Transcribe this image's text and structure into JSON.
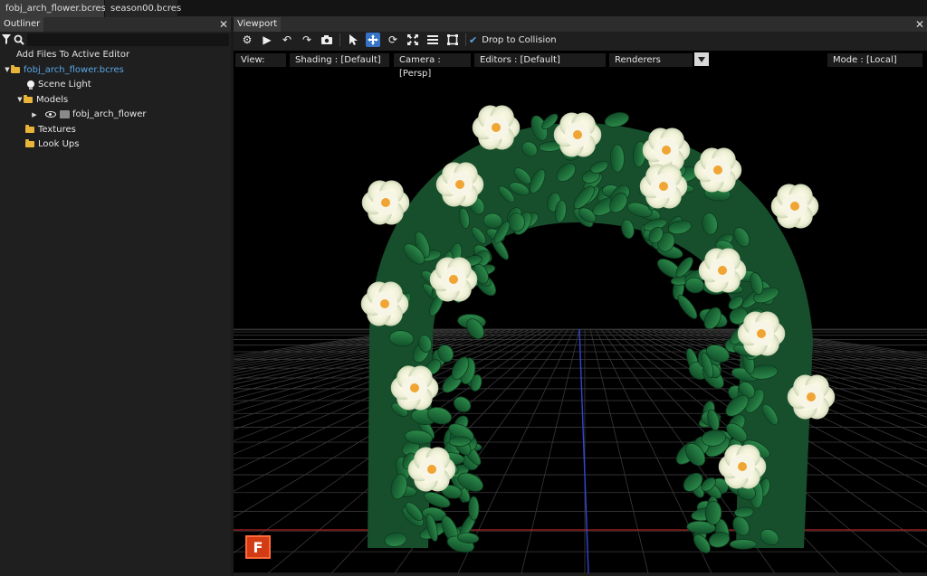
{
  "file_tabs": [
    "fobj_arch_flower.bcres",
    "season00.bcres"
  ],
  "outliner": {
    "title": "Outliner",
    "add_files": "Add Files To Active Editor",
    "tree": {
      "root": "fobj_arch_flower.bcres",
      "scene_light": "Scene Light",
      "models": "Models",
      "model_item": "fobj_arch_flower",
      "textures": "Textures",
      "look_ups": "Look Ups"
    }
  },
  "viewport": {
    "title": "Viewport",
    "drop_to_collision": "Drop to Collision",
    "options": {
      "view": "View:",
      "shading": "Shading : [Default]",
      "camera": "Camera : [Persp]",
      "editors": "Editors : [Default]",
      "renderers": "Renderers",
      "mode": "Mode : [Local]"
    },
    "badge": "F"
  },
  "colors": {
    "accent": "#3573c9",
    "folder": "#e8b53a",
    "link": "#5aa7e6",
    "badge": "#d23b14"
  }
}
